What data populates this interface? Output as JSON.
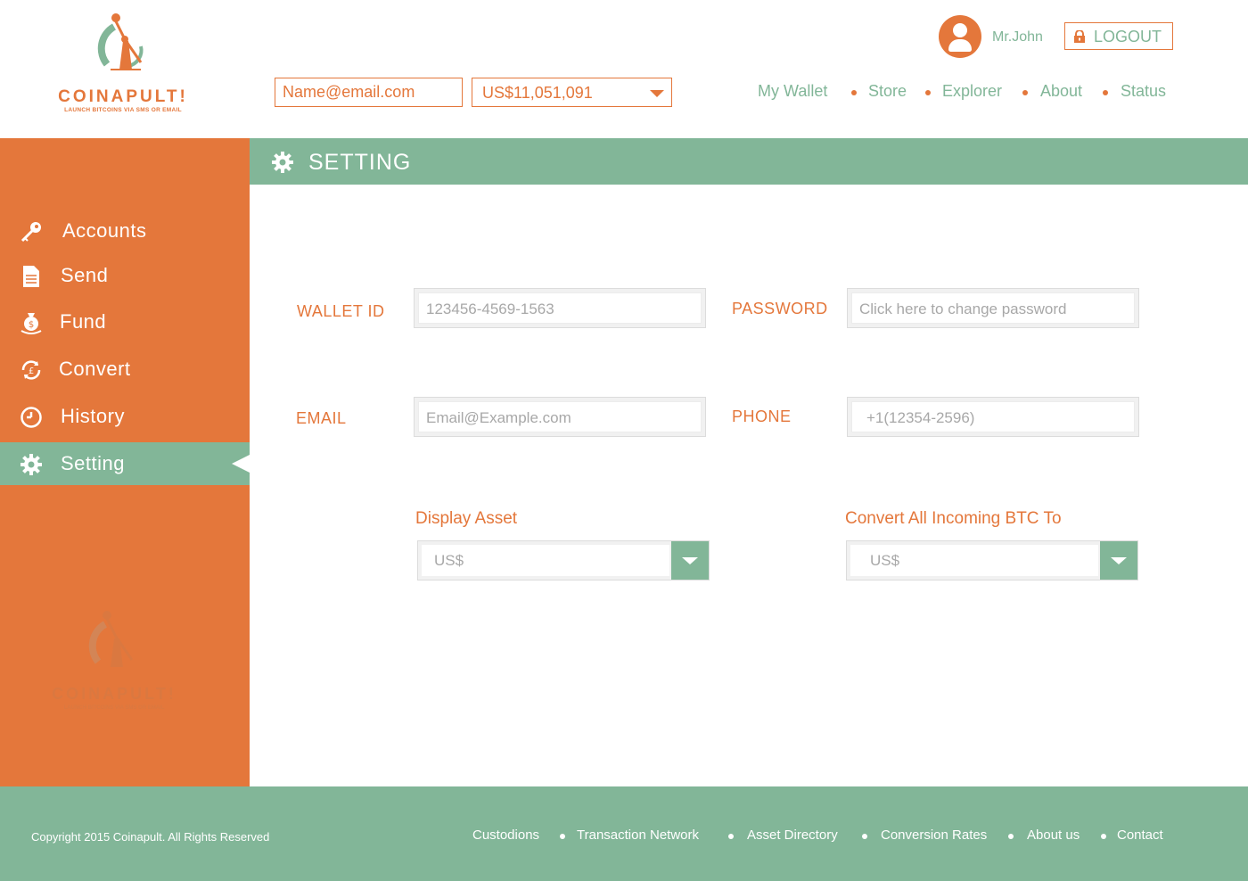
{
  "brand": {
    "name": "COINAPULT!",
    "tagline": "LAUNCH BITCOINS VIA SMS OR EMAIL"
  },
  "header": {
    "search_placeholder": "Name@email.com",
    "balance": "US$11,051,091",
    "username": "Mr.John",
    "logout_label": "LOGOUT",
    "nav": [
      "My Wallet",
      "Store",
      "Explorer",
      "About",
      "Status"
    ]
  },
  "sidebar": {
    "items": [
      {
        "label": "Accounts",
        "icon": "key-icon"
      },
      {
        "label": "Send",
        "icon": "document-icon"
      },
      {
        "label": "Fund",
        "icon": "money-bag-icon"
      },
      {
        "label": "Convert",
        "icon": "currency-exchange-icon"
      },
      {
        "label": "History",
        "icon": "clock-icon"
      },
      {
        "label": "Setting",
        "icon": "gear-icon",
        "active": true
      }
    ]
  },
  "page": {
    "title": "SETTING",
    "fields": {
      "wallet_id": {
        "label": "WALLET ID",
        "value": "123456-4569-1563"
      },
      "password": {
        "label": "PASSWORD",
        "value": "Click here to change password"
      },
      "email": {
        "label": "EMAIL",
        "value": "Email@Example.com"
      },
      "phone": {
        "label": "PHONE",
        "value": "+1(12354-2596)"
      }
    },
    "display_asset": {
      "label": "Display Asset",
      "value": "US$"
    },
    "convert_btc": {
      "label": "Convert All Incoming BTC To",
      "value": "US$"
    }
  },
  "footer": {
    "copyright": "Copyright 2015 Coinapult. All Rights Reserved",
    "links": [
      "Custodions",
      "Transaction Network",
      "Asset Directory",
      "Conversion Rates",
      "About us",
      "Contact"
    ]
  },
  "colors": {
    "brand_orange": "#e4773b",
    "brand_green": "#82b698"
  }
}
